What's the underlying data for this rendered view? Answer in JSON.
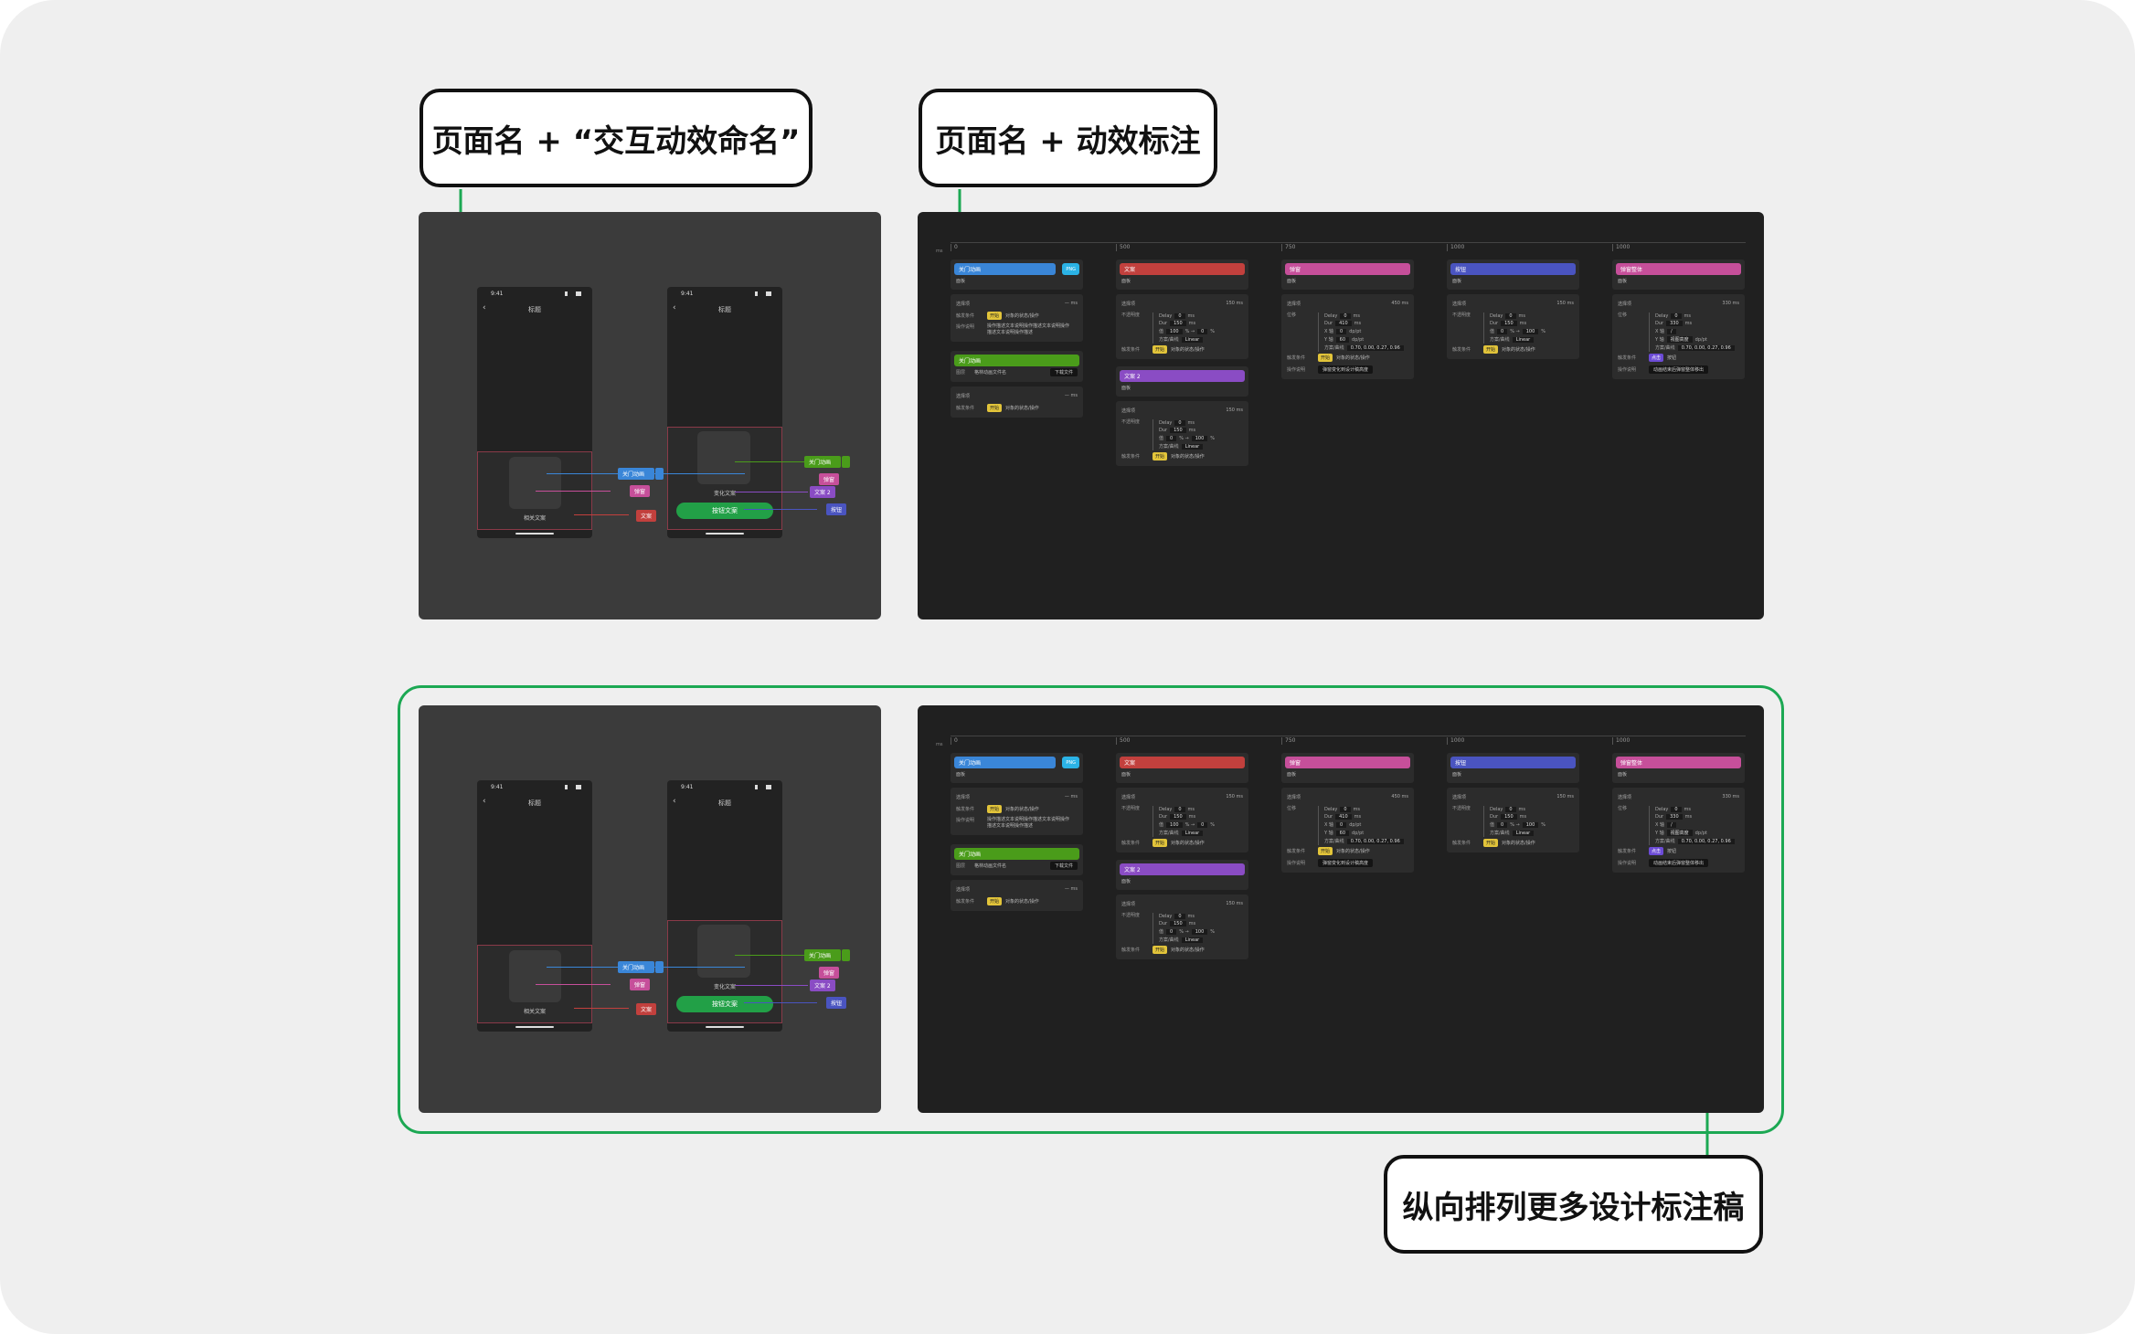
{
  "callouts": {
    "left": "页面名 + “交互动效命名”",
    "middle": "页面名 + 动效标注",
    "bottom": "纵向排列更多设计标注稿"
  },
  "phone": {
    "time": "9:41",
    "title": "标题",
    "sheet1_text": "相关文案",
    "sheet2_text": "变化文案",
    "cta": "按钮文案"
  },
  "tags": {
    "t1": "关门动画",
    "t2": "弹窗",
    "t3": "文案",
    "t4": "弹窗",
    "t5": "文案 2",
    "t6": "按钮"
  },
  "timeline": {
    "unit": "ms",
    "ticks": [
      "0",
      "500",
      "750",
      "1000",
      "1000"
    ],
    "col1": {
      "h1": "关门动画",
      "badge": "PNG",
      "s1": "面板",
      "r1l": "选择项",
      "r1r": "—  ms",
      "trigger_k": "触发条件",
      "trigger_chip": "开始",
      "trigger_v": "对象的状态/操作",
      "desc_k": "操作说明",
      "desc_v": "操作描述文本说明操作描述文本说明操作描述文本说明操作描述",
      "h2": "关门动画",
      "s2k": "图层",
      "s2v": "格林动画文件名",
      "s2b": "下载文件",
      "r2l": "选择项",
      "r2r": "—  ms",
      "trig2_k": "触发条件",
      "trig2_chip": "开始",
      "trig2_v": "对象的状态/操作"
    },
    "col2": {
      "h1": "文案",
      "s1": "面板",
      "r1l": "选择项",
      "r1r": "150  ms",
      "p_k": "不透明度",
      "l1": [
        "Delay",
        "0",
        "ms"
      ],
      "l2": [
        "Dur",
        "150",
        "ms"
      ],
      "l3": [
        "值",
        "100",
        "%  →",
        "0",
        "%"
      ],
      "l4": [
        "方案/曲线",
        "Linear"
      ],
      "trig_k": "触发条件",
      "trig_chip": "开始",
      "trig_v": "对象的状态/操作",
      "h2": "文案 2",
      "s2": "面板",
      "r2l": "选择项",
      "r2r": "150  ms",
      "m3": [
        "值",
        "0",
        "%  →",
        "100",
        "%"
      ]
    },
    "col3": {
      "h1": "弹窗",
      "s1": "面板",
      "r1l": "选择项",
      "r1r": "450  ms",
      "p_k": "位移",
      "l1": [
        "Delay",
        "0",
        "ms"
      ],
      "l2": [
        "Dur",
        "410",
        "ms"
      ],
      "l3": [
        "X 轴",
        "0",
        "dp/pt"
      ],
      "l4": [
        "Y 轴",
        "60",
        "dp/pt"
      ],
      "l5": [
        "方案/曲线",
        "0.70, 0.00, 0.27, 0.96"
      ],
      "trig_k": "触发条件",
      "trig_chip": "开始",
      "trig_v": "对象的状态/操作",
      "desc_k": "操作说明",
      "desc_v": "弹窗变化到设计稿高度"
    },
    "col4": {
      "h1": "按钮",
      "s1": "面板",
      "r1l": "选择项",
      "r1r": "150  ms",
      "p_k": "不透明度",
      "l1": [
        "Delay",
        "0",
        "ms"
      ],
      "l2": [
        "Dur",
        "150",
        "ms"
      ],
      "l3": [
        "值",
        "0",
        "%  →",
        "100",
        "%"
      ],
      "l4": [
        "方案/曲线",
        "Linear"
      ],
      "trig_k": "触发条件",
      "trig_chip": "开始",
      "trig_v": "对象的状态/操作"
    },
    "col5": {
      "h1": "弹窗整体",
      "s1": "面板",
      "r1l": "选择项",
      "r1r": "330  ms",
      "p_k": "位移",
      "l1": [
        "Delay",
        "0",
        "ms"
      ],
      "l2": [
        "Dur",
        "330",
        "ms"
      ],
      "l3": [
        "X 轴",
        "/"
      ],
      "l4": [
        "Y 轴",
        "视图高度",
        "dp/pt"
      ],
      "l5": [
        "方案/曲线",
        "0.70, 0.00, 0.27, 0.96"
      ],
      "trig_k": "触发条件",
      "trig_chip": "点击",
      "trig_v": "按钮",
      "desc_k": "操作说明",
      "desc_v": "动画结束后弹窗整体移出"
    }
  },
  "colors": {
    "frame": "#1ca853",
    "blue": "#3a86d8",
    "red": "#c2403d",
    "pink": "#c64f9a",
    "green": "#4a9c1a",
    "purple": "#8a4cc4",
    "indigo": "#4a54c0",
    "yellow": "#e2c43a",
    "cyan": "#2bb3e6"
  }
}
